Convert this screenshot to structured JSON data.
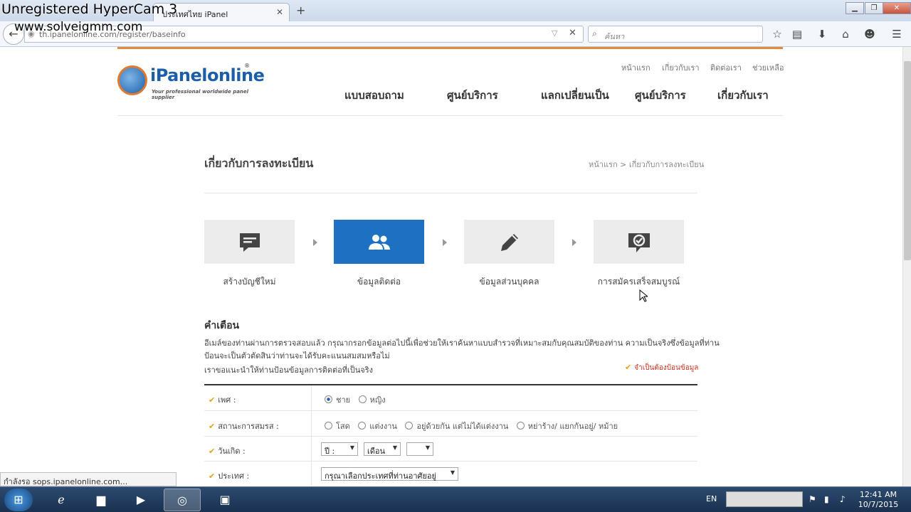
{
  "watermark": {
    "line1": "Unregistered HyperCam 3",
    "line2": "www.solveigmm.com"
  },
  "browser": {
    "tab_title": "ประเทศไทย iPanel",
    "url": "th.ipanelonline.com/register/baseinfo",
    "search_placeholder": "ค้นหา"
  },
  "site": {
    "logo_text": "iPanelonline",
    "logo_tagline": "Your professional worldwide panel supplier",
    "top_links": [
      "หน้าแรก",
      "เกี่ยวกับเรา",
      "ติดต่อเรา",
      "ช่วยเหลือ"
    ],
    "main_nav": [
      "แบบสอบถาม",
      "ศูนย์บริการ",
      "แลกเปลี่ยนเป็น",
      "ศูนย์บริการ",
      "เกี่ยวกับเรา"
    ]
  },
  "page": {
    "title": "เกี่ยวกับการลงทะเบียน",
    "breadcrumb": "หน้าแรก > เกี่ยวกับการลงทะเบียน",
    "steps": [
      {
        "label": "สร้างบัญชีใหม่",
        "icon": "message-icon"
      },
      {
        "label": "ข้อมูลติดต่อ",
        "icon": "users-icon"
      },
      {
        "label": "ข้อมูลส่วนบุคคล",
        "icon": "pencil-icon"
      },
      {
        "label": "การสมัครเสร็จสมบูรณ์",
        "icon": "check-bubble-icon"
      }
    ],
    "active_step": 1,
    "warning_title": "คำเตือน",
    "warning_lines": [
      "อีเมล์ของท่านผ่านการตรวจสอบแล้ว กรุณากรอกข้อมูลต่อไปนี้เพื่อช่วยให้เราค้นหาแบบสำรวจที่เหมาะสมกับคุณสมบัติของท่าน ความเป็นจริงซึ่งข้อมูลที่ท่าน",
      "ป้อนจะเป็นตัวตัดสินว่าท่านจะได้รับคะแนนสมสมหรือไม่",
      "เราขอแนะนำให้ท่านป้อนข้อมูลการติดต่อที่เป็นจริง"
    ],
    "required_note": "จำเป็นต้องป้อนข้อมูล"
  },
  "form": {
    "gender": {
      "label": "เพศ :",
      "options": [
        "ชาย",
        "หญิง"
      ],
      "selected": "ชาย"
    },
    "marital": {
      "label": "สถานะการสมรส :",
      "options": [
        "โสด",
        "แต่งงาน",
        "อยู่ด้วยกัน แต่ไม่ได้แต่งงาน",
        "หย่าร้าง/ แยกกันอยู่/ หม้าย"
      ]
    },
    "birthday": {
      "label": "วันเกิด :",
      "year": "ปี :",
      "month": "เดือน",
      "day": ""
    },
    "country": {
      "label": "ประเทศ :",
      "value": "กรุณาเลือกประเทศที่ท่านอาศัยอยู่"
    }
  },
  "status_bar": "กำลังรอ sops.ipanelonline.com...",
  "taskbar": {
    "lang": "EN",
    "time": "12:41 AM",
    "date": "10/7/2015"
  }
}
